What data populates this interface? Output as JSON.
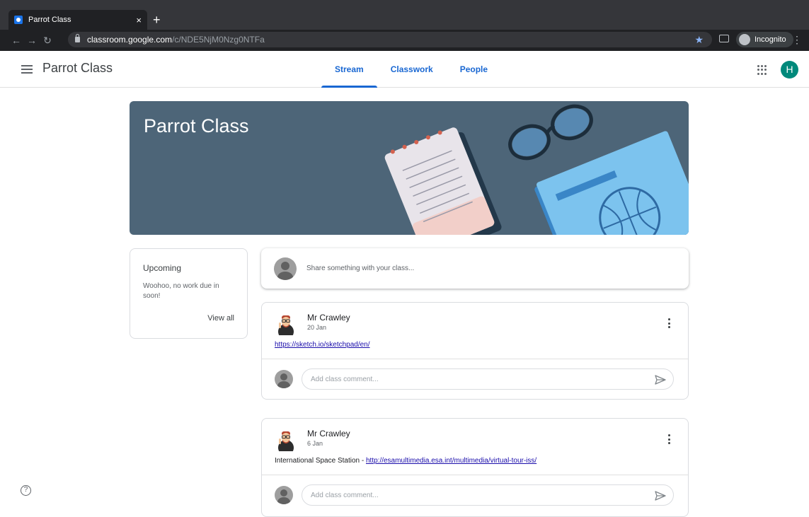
{
  "browser": {
    "tab_title": "Parrot Class",
    "tab_close": "×",
    "new_tab": "+",
    "url_host": "classroom.google.com",
    "url_path": "/c/NDE5NjM0Nzg0NTFa",
    "incognito_label": "Incognito"
  },
  "header": {
    "class_title": "Parrot Class",
    "tabs": [
      {
        "label": "Stream",
        "active": true
      },
      {
        "label": "Classwork",
        "active": false
      },
      {
        "label": "People",
        "active": false
      }
    ],
    "user_initial": "H"
  },
  "banner": {
    "title": "Parrot Class"
  },
  "upcoming": {
    "heading": "Upcoming",
    "message": "Woohoo, no work due in soon!",
    "view_all": "View all"
  },
  "share": {
    "placeholder": "Share something with your class..."
  },
  "posts": [
    {
      "author": "Mr Crawley",
      "date": "20 Jan",
      "prefix": "",
      "link": "https://sketch.io/sketchpad/en/",
      "comment_placeholder": "Add class comment..."
    },
    {
      "author": "Mr Crawley",
      "date": "6 Jan",
      "prefix": "International Space Station - ",
      "link": "http://esamultimedia.esa.int/multimedia/virtual-tour-iss/",
      "comment_placeholder": "Add class comment..."
    }
  ],
  "colors": {
    "accent": "#1967d2",
    "banner": "#4d6578",
    "avatar": "#00897b"
  }
}
